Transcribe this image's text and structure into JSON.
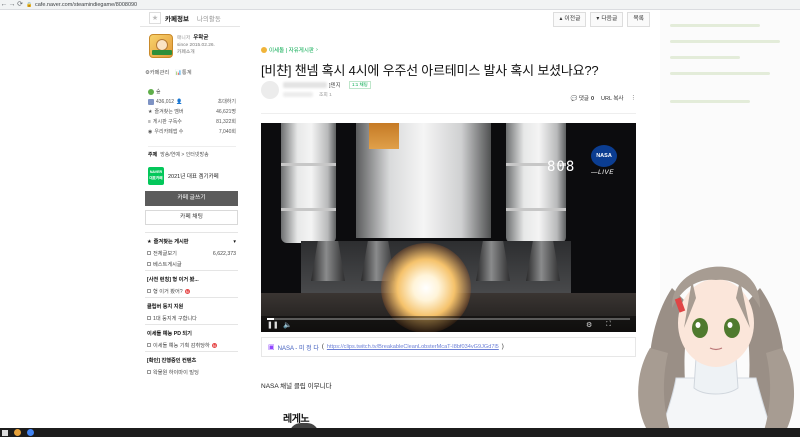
{
  "browser": {
    "url": "cafe.naver.com/steamindiegame/8008090",
    "back_icon": "arrow-left-icon",
    "forward_icon": "arrow-right-icon",
    "reload_icon": "reload-icon"
  },
  "sidebar": {
    "tabs": [
      {
        "label": "카페정보",
        "active": true
      },
      {
        "label": "나의활동",
        "active": false
      }
    ],
    "cafe": {
      "manager_label": "매니저",
      "manager_name": "우왁굳",
      "since": "since 2015.02.26.",
      "intro_link": "카페소개"
    },
    "links": [
      "⚙카페관리",
      "📊통계"
    ],
    "stats": {
      "level_label": "숲",
      "members": "436,012",
      "members_suffix": "👤",
      "invite": "초대하기",
      "rows": [
        {
          "label": "즐겨찾는 멤버",
          "value": "46,621명"
        },
        {
          "label": "게시판 구독수",
          "value": "81,322회"
        },
        {
          "label": "우리카페앱 수",
          "value": "7,040회"
        }
      ]
    },
    "topic": {
      "label": "주제",
      "value": "방송/연예 > 인터넷방송"
    },
    "award": {
      "badge_top": "NAVER",
      "badge_bottom": "대표카페",
      "text": "2021년 대표 겜기카페"
    },
    "write_button": "카페 글쓰기",
    "chat_button": "카페 채팅",
    "menu": {
      "favorites_title": "즐겨찾는 게시판",
      "items": [
        {
          "label": "전체글보기",
          "count": "6,622,373"
        },
        {
          "label": "베스트게시글",
          "count": ""
        }
      ],
      "sections": [
        {
          "title": "[사전 런칭] 형 이거 봤...",
          "item": "형 이거 봤어?"
        },
        {
          "title": "클립버 둥지 지원",
          "item": "1대 둥지게 구합니다"
        },
        {
          "title": "이세돌 예능 PD 되기",
          "item": "이세돌 예능 기획 감취당하"
        },
        {
          "title": "[확인] 진행중인 컨텐츠",
          "item": "왁물원 하이마이 빌딩"
        }
      ]
    }
  },
  "toolbar": {
    "prev": "이전글",
    "next": "다음글",
    "list": "목록"
  },
  "article": {
    "board": "이세돌 | 자유게시판",
    "title": "[비챤] 챈넴 혹시 4시에 우주선 아르테미스 발사 혹시 보셨나요??",
    "author_suffix": "]덴지",
    "level_badge": "1:1 채팅",
    "views": "조회 1",
    "comments_label": "댓글",
    "comments_count": "0",
    "url_copy": "URL 복사",
    "video": {
      "counter": "808",
      "brand": "NASA",
      "live": "LIVE",
      "progress": 0.02
    },
    "clip": {
      "channel": "NASA - 미 정 다",
      "url": "https://clips.twitch.tv/BreakableCleanLobsterMcaT-I8bf034vG9JGd7l5"
    },
    "body_text": "NASA 채널 클립 이무니다",
    "emote_text": "레게노"
  }
}
